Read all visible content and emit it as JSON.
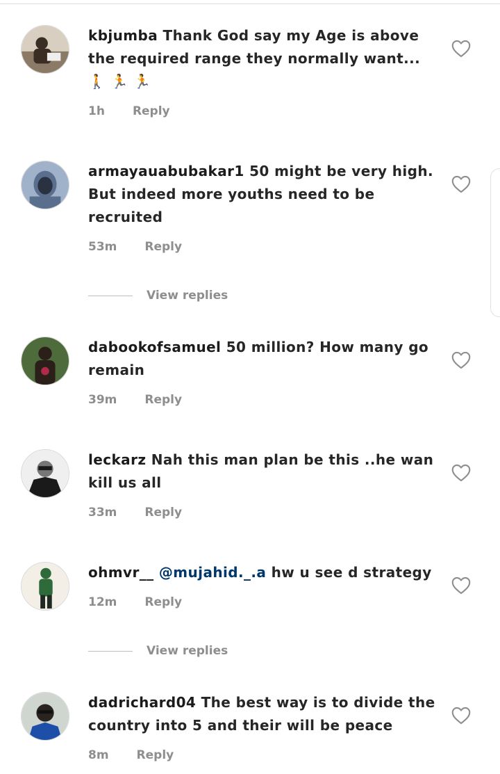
{
  "comments": [
    {
      "username": "kbjumba",
      "text": "Thank God say my Age is above the required range they normally want... 🚶 🏃 🏃",
      "time": "1h",
      "reply_label": "Reply",
      "avatar_colors": [
        "#d8cfc0",
        "#3a2d24",
        "#8a7a66"
      ]
    },
    {
      "username": "armayauabubakar1",
      "text": "50 might be very high. But indeed more youths need to be recruited",
      "time": "53m",
      "reply_label": "Reply",
      "avatar_colors": [
        "#9fb2c9",
        "#2a3140",
        "#5a6f8d"
      ]
    },
    {
      "username": "dabookofsamuel",
      "text": "50 million? How many go remain",
      "time": "39m",
      "reply_label": "Reply",
      "avatar_colors": [
        "#4e6b3c",
        "#2b1f1a",
        "#b02a4a"
      ]
    },
    {
      "username": "leckarz",
      "text": "Nah this man plan be this ..he wan kill us all",
      "time": "33m",
      "reply_label": "Reply",
      "avatar_colors": [
        "#efefef",
        "#1a1a1a",
        "#777777"
      ]
    },
    {
      "username": "ohmvr__",
      "mention": "@mujahid._.a",
      "text": "hw u see d strategy",
      "time": "12m",
      "reply_label": "Reply",
      "avatar_colors": [
        "#f3efe6",
        "#2f6b3a",
        "#1f2a22"
      ]
    },
    {
      "username": "dadrichard04",
      "text": "The best way is to divide the country into 5 and their will be peace",
      "time": "8m",
      "reply_label": "Reply",
      "avatar_colors": [
        "#cfd6cf",
        "#2a2420",
        "#1d4fa8"
      ]
    }
  ],
  "view_replies_label": "View replies",
  "icons": {
    "like": "heart-outline-icon"
  },
  "colors": {
    "text": "#262626",
    "meta": "#8e8e8e",
    "mention": "#00376b"
  }
}
